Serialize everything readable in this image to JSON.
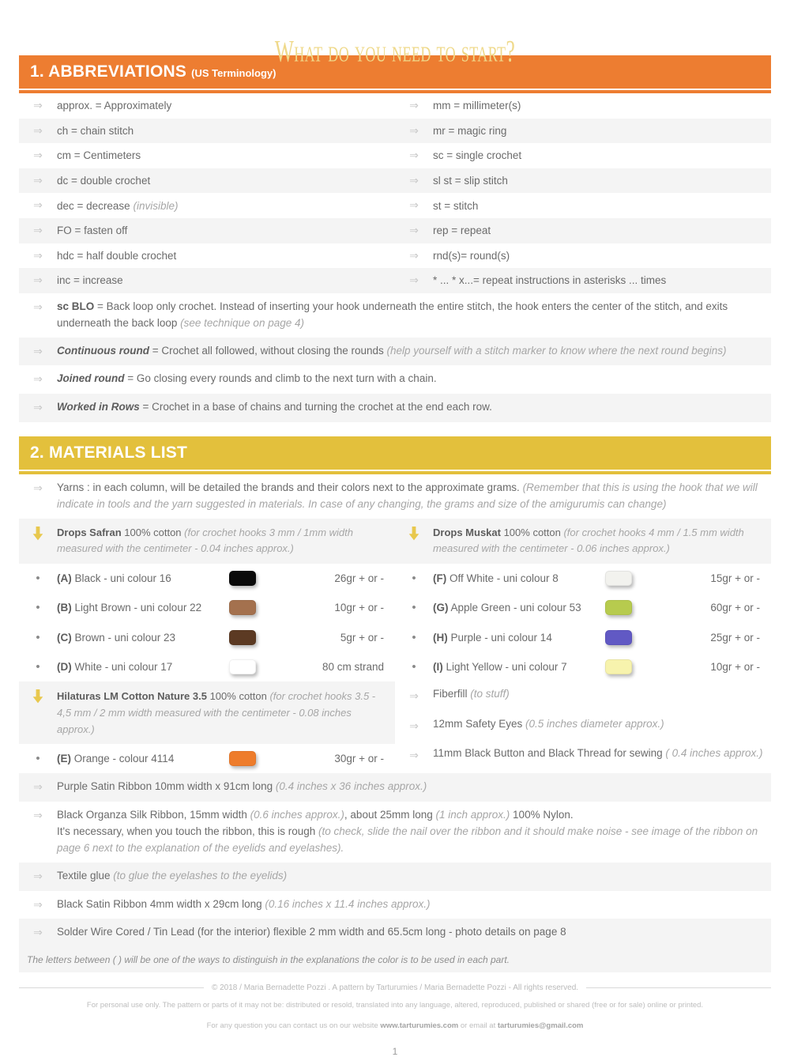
{
  "title": "What do you need to start?",
  "sections": {
    "abbreviations": {
      "number_label": "1. ABBREVIATIONS",
      "subtitle": "(US Terminology)",
      "color": "#ED7D31",
      "pairs": [
        {
          "left": "approx.  =  Approximately",
          "right": "mm = millimeter(s)"
        },
        {
          "left": "ch = chain stitch",
          "right": "mr = magic ring"
        },
        {
          "left": "cm = Centimeters",
          "right": "sc = single crochet"
        },
        {
          "left": "dc = double crochet",
          "right": "sl st = slip stitch"
        },
        {
          "left": "dec = decrease ",
          "left_italic": "(invisible)",
          "right": "st = stitch"
        },
        {
          "left": "FO = fasten off",
          "right": "rep = repeat"
        },
        {
          "left": "hdc = half double crochet",
          "right": "rnd(s)= round(s)"
        },
        {
          "left": "inc = increase",
          "right": "* ... * x...= repeat instructions in asterisks ... times"
        }
      ],
      "long_entries": [
        {
          "bold": "sc BLO",
          "text": " = Back loop only crochet. Instead of inserting your hook underneath the entire stitch, the hook enters the center of the stitch, and exits underneath the back loop ",
          "italic": "(see technique on page 4)"
        },
        {
          "bold_italic": "Continuous round",
          "text": " = Crochet all followed, without closing the rounds ",
          "italic": "(help yourself with a stitch marker to know where the next round begins)"
        },
        {
          "bold_italic": "Joined round",
          "text": " = Go closing every rounds and climb to the next turn with a chain.",
          "italic": ""
        },
        {
          "bold_italic": "Worked in Rows",
          "text": " = Crochet in a base of chains and turning the crochet at the end each row.",
          "italic": ""
        }
      ]
    },
    "materials": {
      "number_label": "2. MATERIALS LIST",
      "color": "#E3C03C",
      "intro": {
        "text": "Yarns : in each column, will be detailed the brands and their colors next to the approximate grams. ",
        "italic": "(Remember that this is using the hook that we will indicate in tools and the yarn suggested in materials. In case of any changing, the grams and size of the amigurumis can change)"
      },
      "brands": [
        {
          "name": "Drops Safran",
          "composition": " 100% cotton ",
          "note": "(for crochet hooks 3 mm / 1mm width measured with the centimeter - 0.04 inches approx.)",
          "yarns": [
            {
              "letter": "(A)",
              "name": " Black - uni colour 16",
              "color": "#0a0a0a",
              "grams": "26gr + or  -"
            },
            {
              "letter": "(B)",
              "name": " Light Brown - uni colour 22",
              "color": "#a4714e",
              "grams": "10gr + or  -"
            },
            {
              "letter": "(C)",
              "name": " Brown - uni colour 23",
              "color": "#5c3a23",
              "grams": "5gr + or  -"
            },
            {
              "letter": "(D)",
              "name": " White - uni colour 17",
              "color": "#ffffff",
              "grams": "80 cm  strand"
            }
          ]
        },
        {
          "name": "Drops Muskat",
          "composition": " 100% cotton ",
          "note": "(for crochet hooks 4 mm / 1.5 mm width measured with the centimeter - 0.06 inches approx.)",
          "yarns": [
            {
              "letter": "(F)",
              "name": " Off White - uni colour 8",
              "color": "#f2f2ee",
              "grams": "15gr + or  -"
            },
            {
              "letter": "(G)",
              "name": " Apple Green -  uni colour 53",
              "color": "#b7cb4e",
              "grams": "60gr + or  -"
            },
            {
              "letter": "(H)",
              "name": " Purple - uni colour 14",
              "color": "#6159c4",
              "grams": "25gr + or  -"
            },
            {
              "letter": "(I)",
              "name": " Light Yellow - uni colour 7",
              "color": "#f7f3ad",
              "grams": "10gr + or  -"
            }
          ]
        }
      ],
      "third_brand": {
        "name": "Hilaturas LM Cotton Nature 3.5",
        "composition": " 100% cotton ",
        "note": "(for crochet hooks 3.5 - 4,5 mm / 2 mm width measured with the centimeter - 0.08 inches approx.)",
        "yarn": {
          "letter": "(E)",
          "name": " Orange - colour  4114",
          "color": "#ee7c2b",
          "grams": "30gr + or  -"
        }
      },
      "right_items": [
        {
          "text": "Fiberfill ",
          "italic": "(to stuff)"
        },
        {
          "text": "12mm Safety Eyes ",
          "italic": "(0.5 inches diameter approx.)"
        },
        {
          "text": "11mm Black Button and Black Thread for sewing ",
          "italic": "( 0.4 inches approx.)"
        }
      ],
      "other_items": [
        {
          "text": "Purple Satin Ribbon 10mm width x 91cm long ",
          "italic": "(0.4 inches x 36 inches approx.)",
          "text2": "",
          "italic2": "",
          "text3": ""
        },
        {
          "text": "Black Organza Silk Ribbon, 15mm width ",
          "italic": "(0.6 inches approx.)",
          "text2": ", about 25mm long ",
          "italic2": "(1 inch approx.)",
          "text3": " 100% Nylon.",
          "line2_text": "It's necessary, when you touch the ribbon, this is rough ",
          "line2_italic": "(to check, slide the nail over the ribbon and it should make noise - see image of the ribbon on page 6 next to the explanation of the eyelids and eyelashes)."
        },
        {
          "text": " Textile glue ",
          "italic": "(to glue the eyelashes to the eyelids)",
          "text2": "",
          "italic2": "",
          "text3": ""
        },
        {
          "text": "Black Satin Ribbon 4mm width x 29cm long ",
          "italic": "(0.16 inches x 11.4 inches approx.)",
          "text2": "",
          "italic2": "",
          "text3": ""
        },
        {
          "text": "Solder Wire Cored / Tin Lead (for the interior) flexible 2 mm width and 65.5cm long - photo details on page 8",
          "italic": "",
          "text2": "",
          "italic2": "",
          "text3": ""
        }
      ],
      "footnote": "The letters between ( ) will be one of the ways to distinguish in the explanations the color is to be used in each part."
    }
  },
  "footer": {
    "copyright": "© 2018 / Maria Bernadette Pozzi . A pattern by Tarturumies / Maria Bernadette Pozzi - All rights reserved.",
    "terms": "For personal use only. The pattern or parts of it may not be: distributed or resold, translated into any language, altered, reproduced, published or shared (free or for sale) online or printed.",
    "contact_pre": "For any question you can contact us on our website  ",
    "website": "www.tarturumies.com",
    "contact_mid": " or email at ",
    "email": "tarturumies@gmail.com",
    "page_number": "1"
  },
  "icons": {
    "arrow": "⇒",
    "bullet": "•"
  }
}
